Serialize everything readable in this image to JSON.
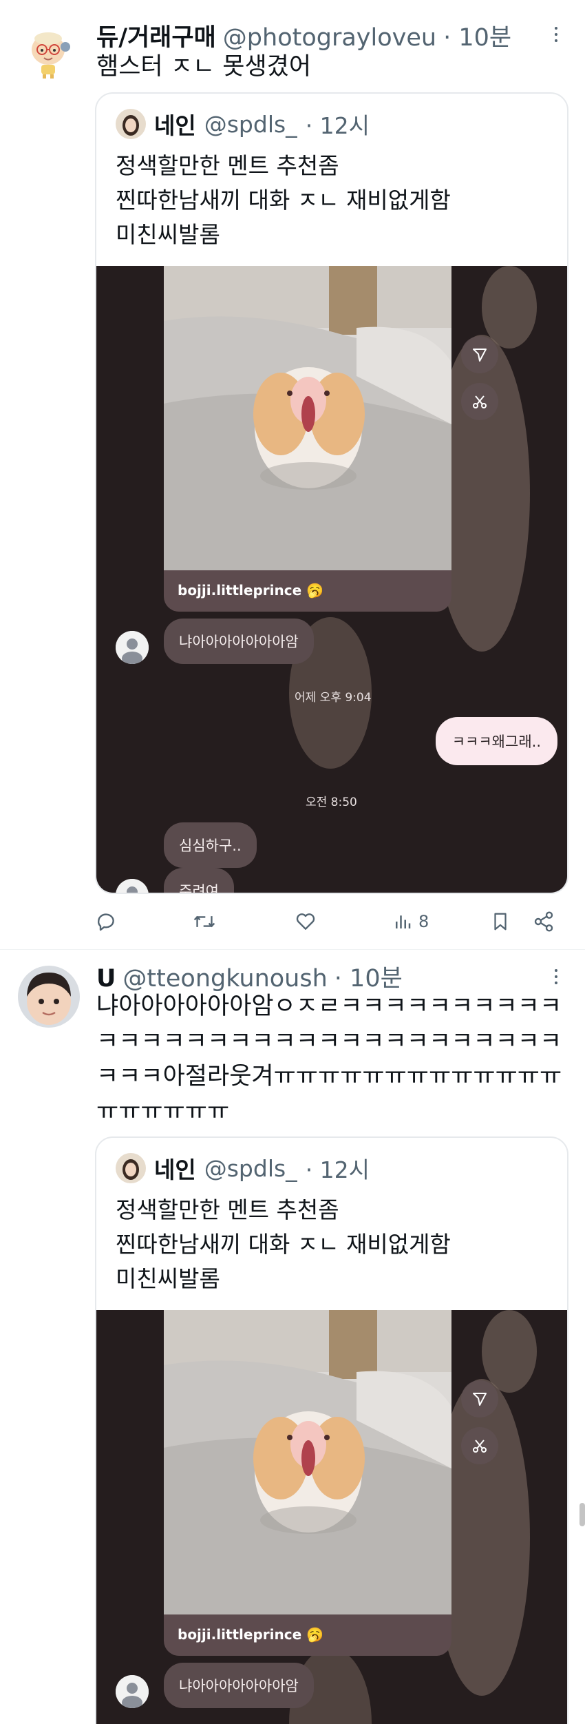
{
  "tweet1": {
    "display_name": "듀/거래구매",
    "handle": "@photograyloveu",
    "time": "· 10분",
    "text": "햄스터 ㅈㄴ 못생겼어",
    "quote": {
      "display_name": "네인",
      "handle": "@spdls_",
      "time": "· 12시",
      "lines": [
        "정색할만한 멘트 추천좀",
        "찐따한남새끼 대화 ㅈㄴ 재비없게함",
        "미친씨발롬"
      ],
      "media": {
        "caption": "bojji.littleprince 🥱",
        "received_1": "냐아아아아아아아암",
        "timestamp_1": "어제 오후 9:04",
        "sent_1": "ㅋㅋㅋ왜그래..",
        "timestamp_2": "오전 8:50",
        "received_2": "심심하구..",
        "received_3": "주려여"
      }
    },
    "actions": {
      "reply": "",
      "retweet": "",
      "like": "",
      "views": "8",
      "bookmark": "",
      "share": ""
    }
  },
  "tweet2": {
    "display_name": "U",
    "handle": "@tteongkunoush",
    "time": "· 10분",
    "text": "냐아아아아아아암ㅇㅈㄹㅋㅋㅋㅋㅋㅋㅋㅋㅋㅋㅋㅋㅋㅋㅋㅋㅋㅋㅋㅋㅋㅋㅋㅋㅋㅋㅋㅋㅋㅋㅋㅋㅋㅋ아절라웃겨ㅠㅠㅠㅠㅠㅠㅠㅠㅠㅠㅠㅠㅠㅠㅠㅠㅠㅠㅠ",
    "quote": {
      "display_name": "네인",
      "handle": "@spdls_",
      "time": "· 12시",
      "lines": [
        "정색할만한 멘트 추천좀",
        "찐따한남새끼 대화 ㅈㄴ 재비없게함",
        "미친씨발롬"
      ],
      "media": {
        "caption": "bojji.littleprince 🥱",
        "received_1": "냐아아아아아아아암"
      }
    }
  },
  "colors": {
    "text_primary": "#0f1419",
    "text_secondary": "#536471",
    "media_bg": "#251d1e",
    "bubble_in": "#5a4b4d",
    "bubble_out": "#fbe9ee"
  },
  "icons": [
    "more-icon",
    "reply-icon",
    "retweet-icon",
    "like-icon",
    "views-icon",
    "bookmark-icon",
    "share-icon",
    "send-icon",
    "scissors-icon",
    "default-avatar-icon"
  ]
}
